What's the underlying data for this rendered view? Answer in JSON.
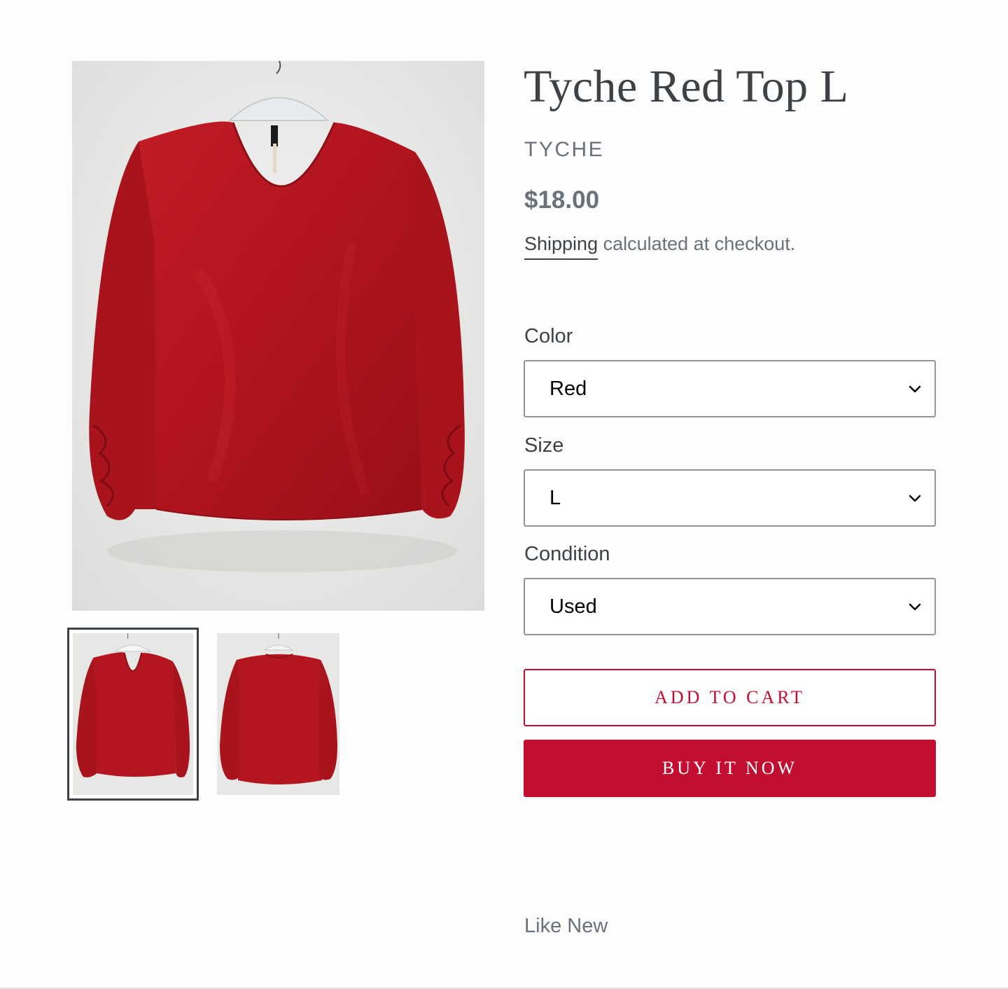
{
  "product": {
    "title": "Tyche Red Top L",
    "vendor": "TYCHE",
    "price": "$18.00",
    "shipping_link": "Shipping",
    "shipping_text": " calculated at checkout.",
    "description": "Like New",
    "image_alt": "Red blouse on hanger",
    "selected_thumbnail": 1
  },
  "options": {
    "color": {
      "label": "Color",
      "value": "Red"
    },
    "size": {
      "label": "Size",
      "value": "L"
    },
    "condition": {
      "label": "Condition",
      "value": "Used"
    }
  },
  "buttons": {
    "add_to_cart": "ADD TO CART",
    "buy_now": "BUY IT NOW"
  },
  "colors": {
    "accent": "#c20f31",
    "heading": "#3d4246",
    "muted": "#69727b",
    "garment": "#b3161f"
  },
  "icons": {
    "select_arrow": "chevron-down-icon"
  }
}
